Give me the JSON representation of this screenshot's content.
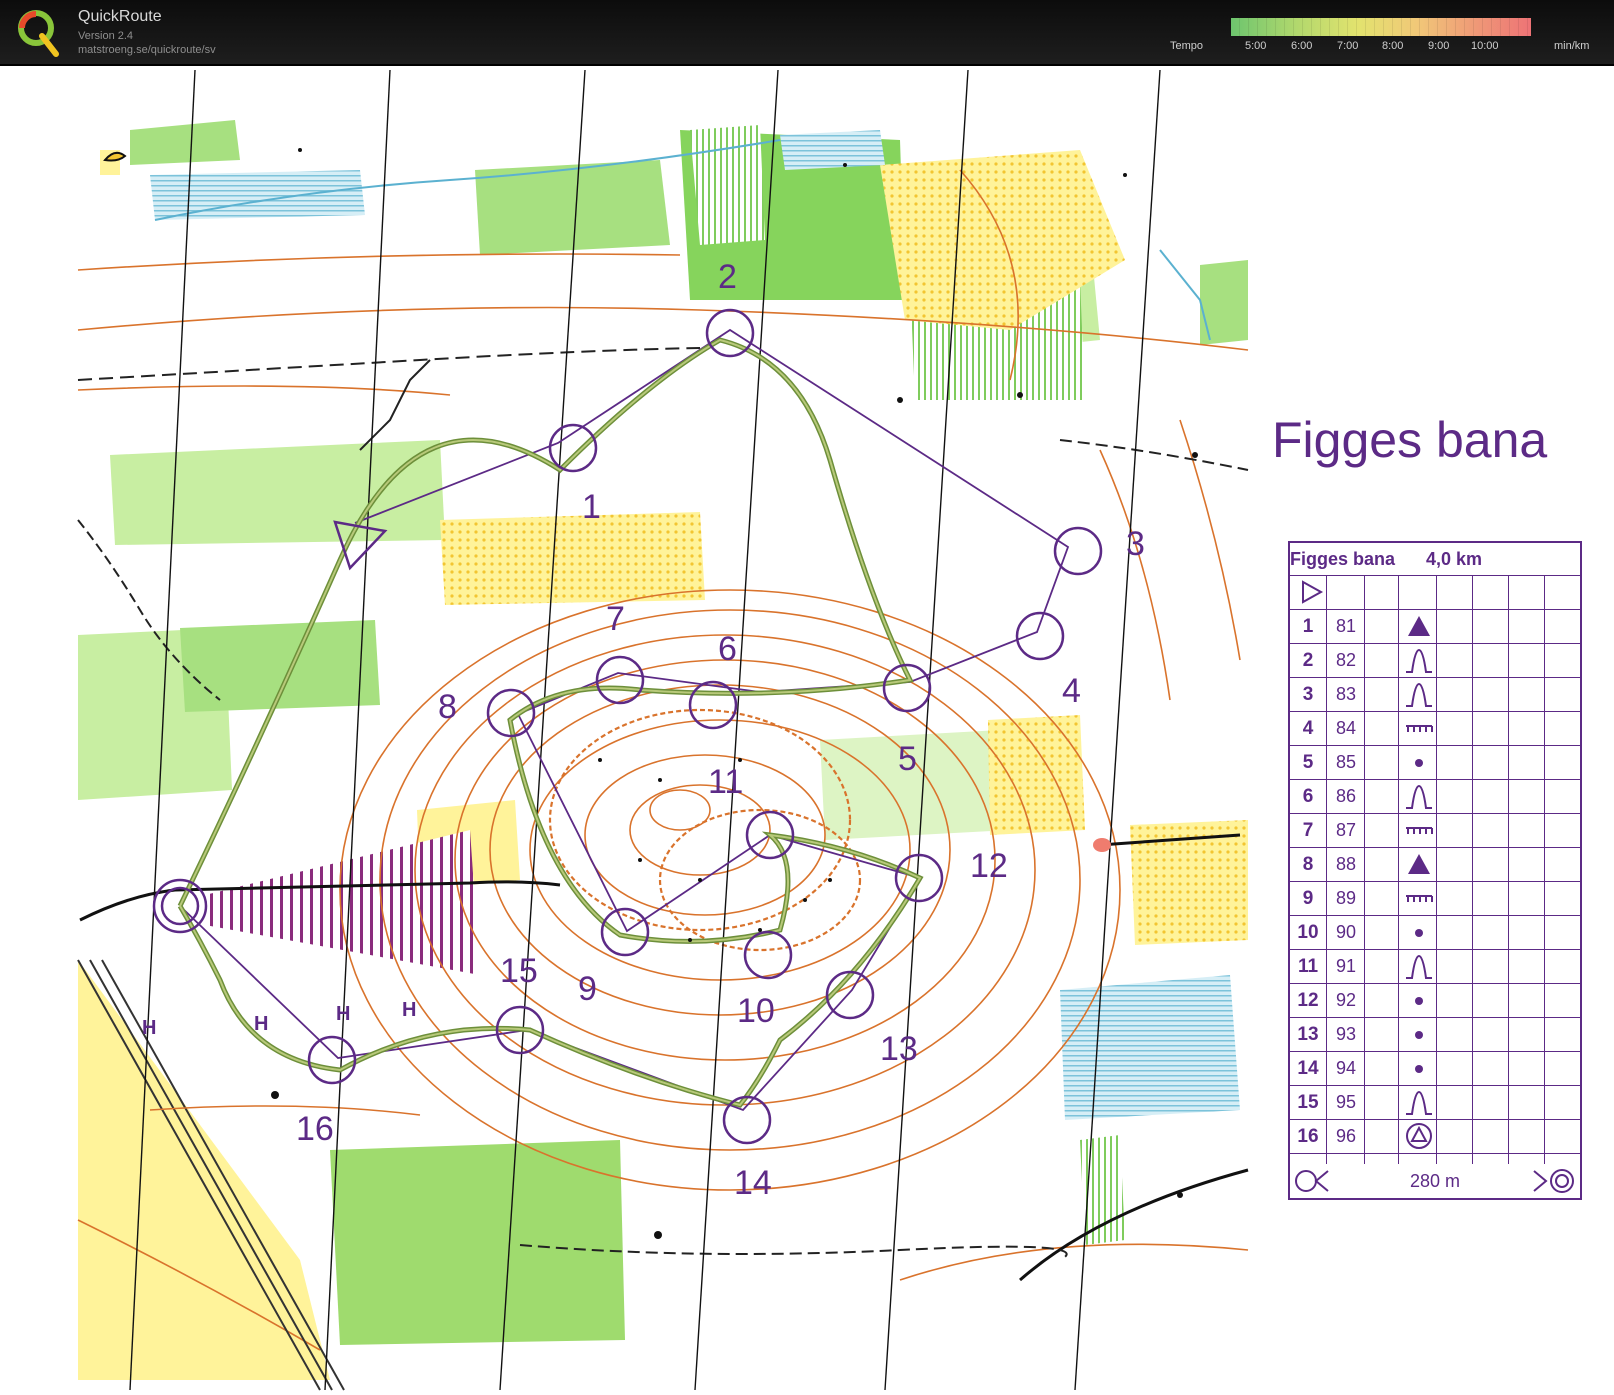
{
  "app": {
    "name": "QuickRoute",
    "version": "Version 2.4",
    "url": "matstroeng.se/quickroute/sv"
  },
  "tempo": {
    "label": "Tempo",
    "ticks": [
      "5:00",
      "6:00",
      "7:00",
      "8:00",
      "9:00",
      "10:00"
    ],
    "unit": "min/km",
    "colors": [
      "#6dc56e",
      "#b2d86d",
      "#e2e36e",
      "#f1c878",
      "#ef9877",
      "#ee7376"
    ]
  },
  "map": {
    "course_title": "Figges bana",
    "course_color": "#5c2a86",
    "route_color": "#6d8f3a",
    "control_labels": [
      "1",
      "2",
      "3",
      "4",
      "5",
      "6",
      "7",
      "8",
      "9",
      "10",
      "11",
      "12",
      "13",
      "14",
      "15",
      "16"
    ],
    "road_labels": [
      "H",
      "H",
      "H",
      "H"
    ]
  },
  "description": {
    "course": "Figges bana",
    "length": "4,0 km",
    "finish_distance": "280 m",
    "controls": [
      {
        "num": "1",
        "code": "81",
        "symbol": "triangle-filled-icon"
      },
      {
        "num": "2",
        "code": "82",
        "symbol": "spur-icon"
      },
      {
        "num": "3",
        "code": "83",
        "symbol": "spur-icon"
      },
      {
        "num": "4",
        "code": "84",
        "symbol": "terrace-icon"
      },
      {
        "num": "5",
        "code": "85",
        "symbol": "dot-icon"
      },
      {
        "num": "6",
        "code": "86",
        "symbol": "spur-icon"
      },
      {
        "num": "7",
        "code": "87",
        "symbol": "terrace-icon"
      },
      {
        "num": "8",
        "code": "88",
        "symbol": "triangle-filled-icon"
      },
      {
        "num": "9",
        "code": "89",
        "symbol": "terrace-icon"
      },
      {
        "num": "10",
        "code": "90",
        "symbol": "dot-icon"
      },
      {
        "num": "11",
        "code": "91",
        "symbol": "spur-icon"
      },
      {
        "num": "12",
        "code": "92",
        "symbol": "dot-icon"
      },
      {
        "num": "13",
        "code": "93",
        "symbol": "dot-icon"
      },
      {
        "num": "14",
        "code": "94",
        "symbol": "dot-icon"
      },
      {
        "num": "15",
        "code": "95",
        "symbol": "spur-icon"
      },
      {
        "num": "16",
        "code": "96",
        "symbol": "triangle-in-circle-icon"
      }
    ]
  }
}
